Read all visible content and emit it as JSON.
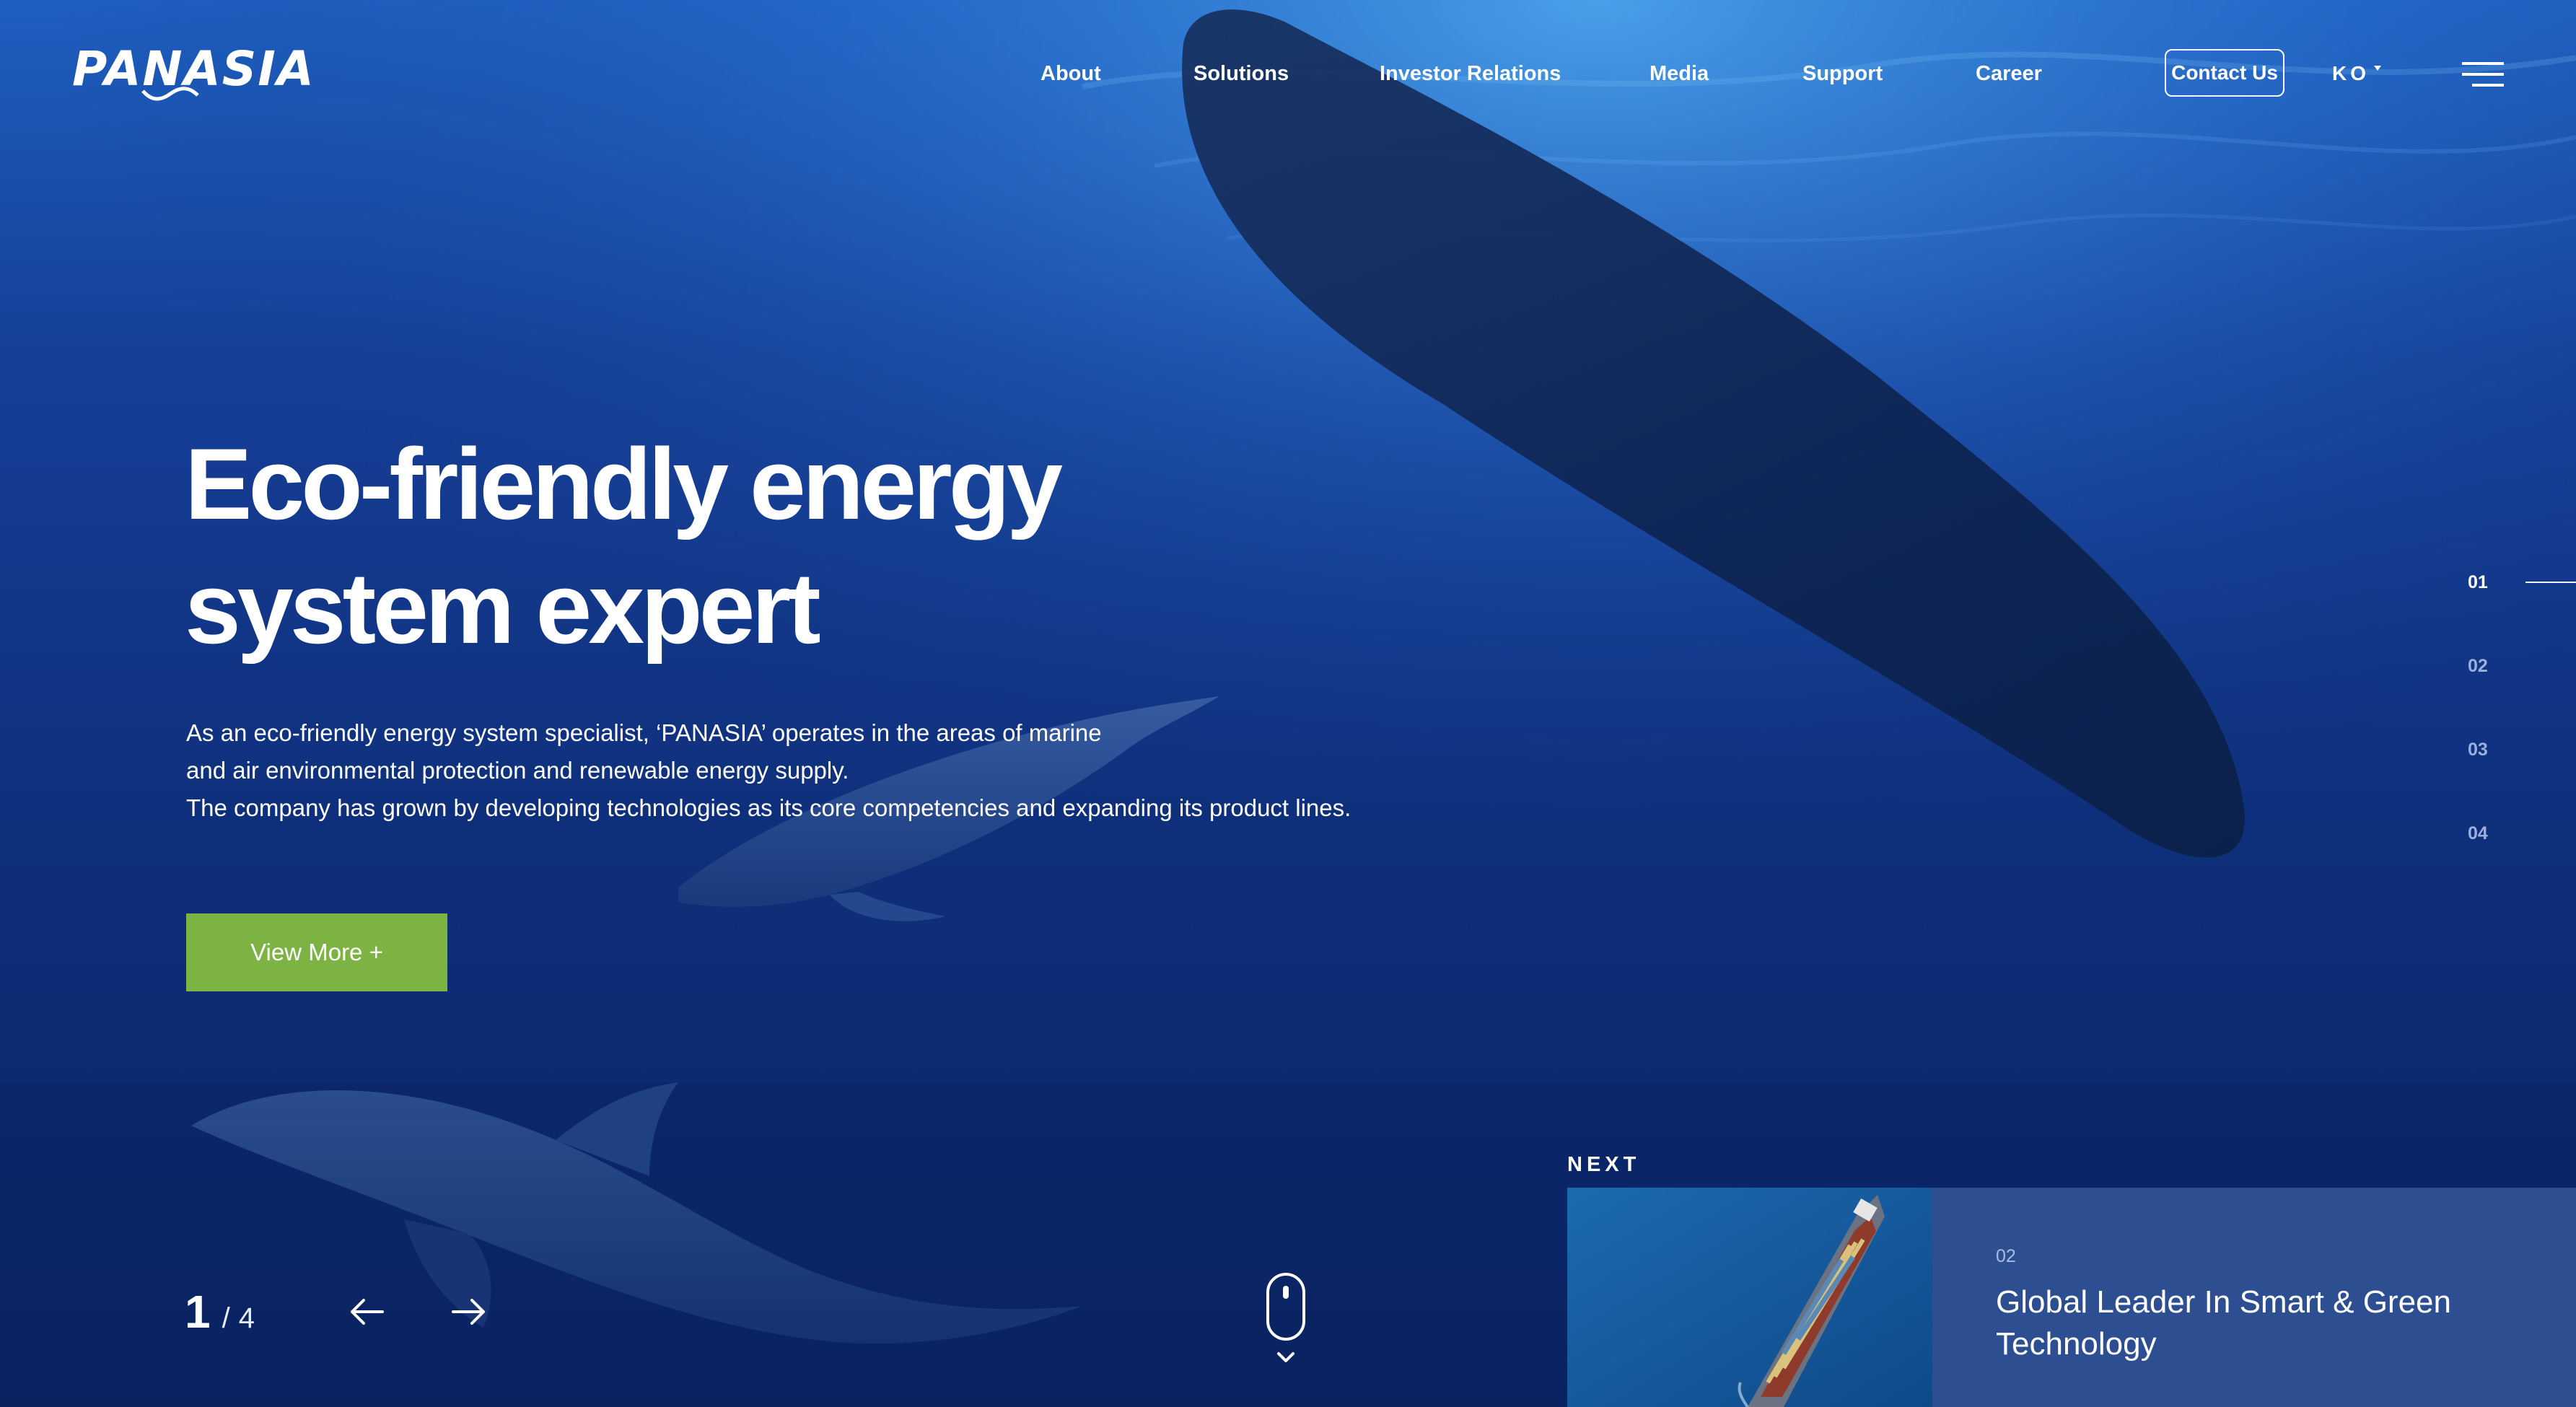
{
  "brand": {
    "logo_text": "PANASIA",
    "colors": {
      "ocean": "#0b2a6e",
      "accent_green": "#7cb342",
      "card_blue": "#2d4f92",
      "text": "#ffffff"
    }
  },
  "nav": {
    "items": [
      "About",
      "Solutions",
      "Investor Relations",
      "Media",
      "Support",
      "Career"
    ],
    "contact_label": "Contact Us",
    "language": "KO",
    "menu_icon": "hamburger-icon"
  },
  "hero": {
    "title_line1": "Eco-friendly energy",
    "title_line2": "system expert",
    "desc_line1": "As an eco-friendly energy system specialist, ‘PANASIA’ operates in the areas of marine",
    "desc_line2": "and air environmental protection and renewable energy supply.",
    "desc_line3": "The company has grown by developing technologies as its core competencies and expanding its product lines.",
    "cta_label": "View More +"
  },
  "pagination": {
    "items": [
      "01",
      "02",
      "03",
      "04"
    ],
    "active_index": 0,
    "current": "1",
    "separator": "/",
    "total": "4",
    "prev_icon": "arrow-left-icon",
    "next_icon": "arrow-right-icon",
    "scroll_icon": "mouse-scroll-icon"
  },
  "next_slide": {
    "label": "NEXT",
    "number": "02",
    "title": "Global Leader In Smart & Green Technology",
    "thumbnail": "container-ship-aerial"
  }
}
